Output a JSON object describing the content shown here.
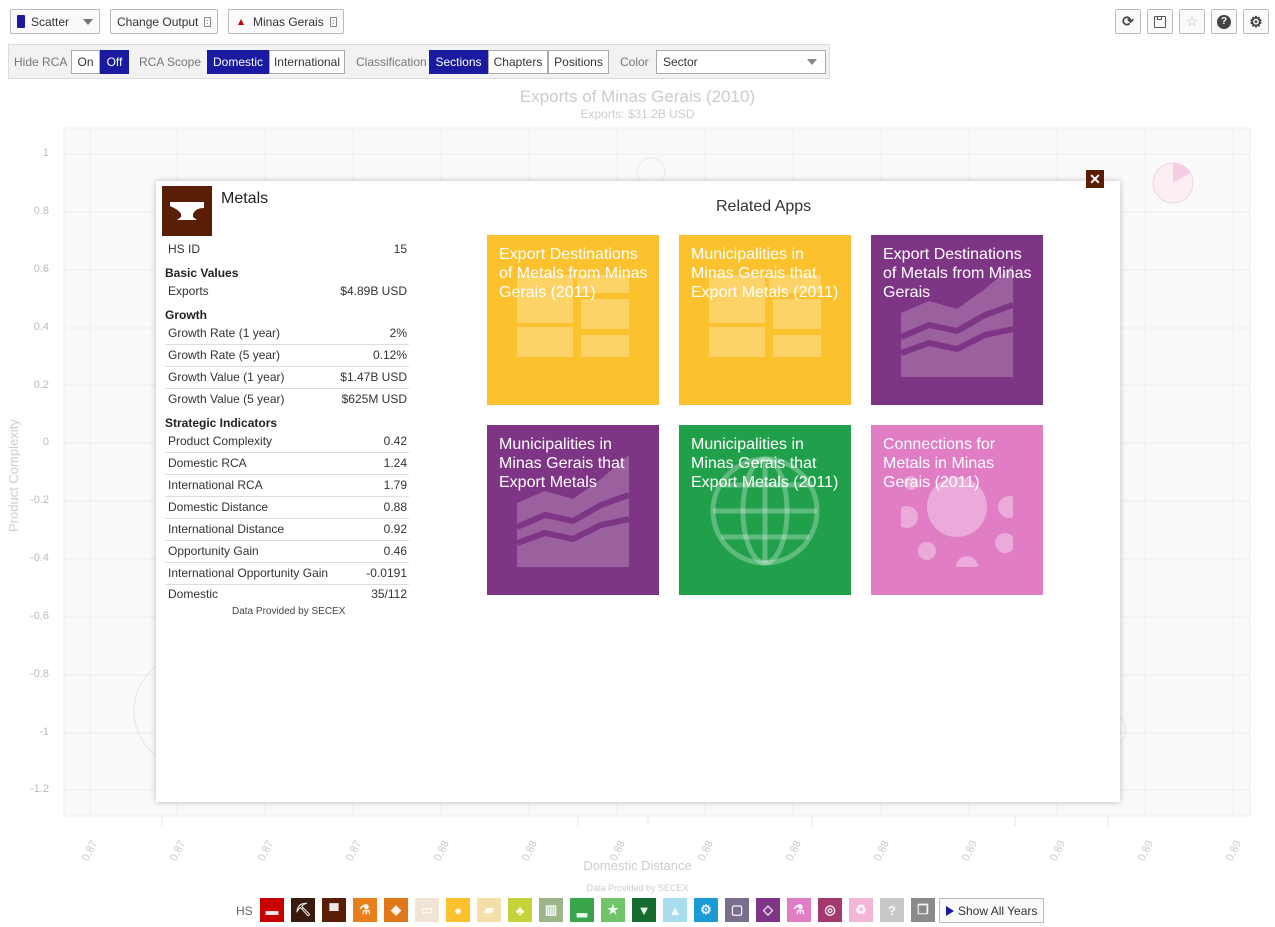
{
  "toolbar": {
    "scatter_label": "Scatter",
    "change_output_label": "Change Output",
    "location_label": "Minas Gerais"
  },
  "controls": {
    "hide_rca_label": "Hide RCA",
    "hide_rca_on": "On",
    "hide_rca_off": "Off",
    "rca_scope_label": "RCA Scope",
    "rca_domestic": "Domestic",
    "rca_international": "International",
    "classification_label": "Classification",
    "class_sections": "Sections",
    "class_chapters": "Chapters",
    "class_positions": "Positions",
    "color_label": "Color",
    "color_value": "Sector"
  },
  "chart": {
    "title": "Exports of Minas Gerais (2010)",
    "subtitle": "Exports: $31.2B USD",
    "ylabel": "Product Complexity",
    "xlabel": "Domestic Distance",
    "source": "Data Provided by SECEX",
    "y_ticks": [
      "1",
      "0.8",
      "0.6",
      "0.4",
      "0.2",
      "0",
      "-0.2",
      "-0.4",
      "-0.6",
      "-0.8",
      "-1",
      "-1.2"
    ],
    "x_ticks": [
      "0.87",
      "0.87",
      "0.87",
      "0.87",
      "0.88",
      "0.88",
      "0.88",
      "0.88",
      "0.88",
      "0.88",
      "0.89",
      "0.89",
      "0.89",
      "0.89"
    ]
  },
  "modal": {
    "product_name": "Metals",
    "hs_id_label": "HS ID",
    "hs_id_value": "15",
    "basic_values_heading": "Basic Values",
    "exports_label": "Exports",
    "exports_value": "$4.89B USD",
    "growth_heading": "Growth",
    "growth_rows": [
      {
        "label": "Growth Rate (1 year)",
        "value": "2%"
      },
      {
        "label": "Growth Rate (5 year)",
        "value": "0.12%"
      },
      {
        "label": "Growth Value (1 year)",
        "value": "$1.47B USD"
      },
      {
        "label": "Growth Value (5 year)",
        "value": "$625M USD"
      }
    ],
    "strategic_heading": "Strategic Indicators",
    "strategic_rows": [
      {
        "label": "Product Complexity",
        "value": "0.42"
      },
      {
        "label": "Domestic RCA",
        "value": "1.24"
      },
      {
        "label": "International RCA",
        "value": "1.79"
      },
      {
        "label": "Domestic Distance",
        "value": "0.88"
      },
      {
        "label": "International Distance",
        "value": "0.92"
      },
      {
        "label": "Opportunity Gain",
        "value": "0.46"
      },
      {
        "label": "International Opportunity Gain",
        "value": "-0.0191"
      },
      {
        "label": "Domestic",
        "value": "35/112"
      }
    ],
    "provided_by": "Data Provided by SECEX",
    "related_title": "Related Apps",
    "close_glyph": "✕",
    "apps": [
      {
        "title": "Export Destinations of Metals from Minas Gerais (2011)",
        "color": "#fcc22d",
        "icon": "treemap-icon"
      },
      {
        "title": "Municipalities in Minas Gerais that Export Metals (2011)",
        "color": "#fcc22d",
        "icon": "treemap-icon"
      },
      {
        "title": "Export Destinations of Metals from Minas Gerais",
        "color": "#7f3585",
        "icon": "stacked-area-icon"
      },
      {
        "title": "Municipalities in Minas Gerais that Export Metals",
        "color": "#7f3585",
        "icon": "stacked-area-icon"
      },
      {
        "title": "Municipalities in Minas Gerais that Export Metals (2011)",
        "color": "#21a04b",
        "icon": "globe-icon"
      },
      {
        "title": "Connections for Metals in Minas Gerais (2011)",
        "color": "#e07dc5",
        "icon": "network-icon"
      }
    ]
  },
  "bottom": {
    "hs_label": "HS",
    "show_all_years": "Show All Years",
    "sections": [
      {
        "name": "animal-products-icon",
        "color": "#c80000"
      },
      {
        "name": "minerals-icon",
        "color": "#3a1a0a"
      },
      {
        "name": "metals-icon",
        "color": "#5a1d06"
      },
      {
        "name": "chemicals-icon",
        "color": "#e87f1a"
      },
      {
        "name": "plastics-icon",
        "color": "#e0781a"
      },
      {
        "name": "paper-icon",
        "color": "#f0e4d4"
      },
      {
        "name": "foodstuffs-icon",
        "color": "#fcc22d"
      },
      {
        "name": "hides-icon",
        "color": "#f5dfa8"
      },
      {
        "name": "vegetable-products-icon",
        "color": "#c4d33a"
      },
      {
        "name": "stone-glass-icon",
        "color": "#9cb68a"
      },
      {
        "name": "footwear-icon",
        "color": "#38a44b"
      },
      {
        "name": "misc-products-icon",
        "color": "#71c46a"
      },
      {
        "name": "textiles-icon",
        "color": "#166b2e"
      },
      {
        "name": "transportation-icon",
        "color": "#a8ddf0"
      },
      {
        "name": "machines-icon",
        "color": "#1b9ad6"
      },
      {
        "name": "arts-icon",
        "color": "#7b6d8c"
      },
      {
        "name": "precious-metals-icon",
        "color": "#7f3585"
      },
      {
        "name": "instruments-icon",
        "color": "#e07dc5"
      },
      {
        "name": "weapons-icon",
        "color": "#a33a6e"
      },
      {
        "name": "recycling-icon",
        "color": "#f4b6d6"
      },
      {
        "name": "unknown-icon",
        "color": "#c8c8c8"
      },
      {
        "name": "other-icon",
        "color": "#8a8a8a"
      }
    ]
  }
}
